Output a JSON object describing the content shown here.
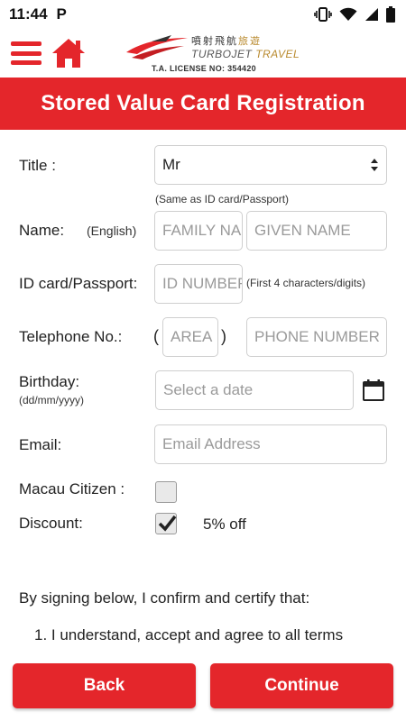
{
  "status_bar": {
    "time": "11:44",
    "app_badge": "P"
  },
  "header": {
    "logo": {
      "chinese_name": "噴射飛航",
      "chinese_suffix": "旅遊",
      "english_name": "TURBOJET",
      "english_suffix": "TRAVEL",
      "license": "T.A. LICENSE NO: 354420"
    },
    "icons": [
      "menu-icon",
      "home-icon"
    ]
  },
  "page_title": "Stored Value Card Registration",
  "form": {
    "title": {
      "label": "Title :",
      "value": "Mr",
      "note": "(Same as ID card/Passport)"
    },
    "name": {
      "label": "Name:",
      "sublabel": "(English)",
      "family_placeholder": "FAMILY NAME",
      "given_placeholder": "GIVEN NAME"
    },
    "id_card": {
      "label": "ID card/Passport:",
      "placeholder": "ID NUMBER",
      "note": "(First 4 characters/digits)"
    },
    "telephone": {
      "label": "Telephone No.:",
      "open_paren": "(",
      "close_paren": ")",
      "area_placeholder": "AREA",
      "phone_placeholder": "PHONE NUMBER"
    },
    "birthday": {
      "label": "Birthday:",
      "sublabel": "(dd/mm/yyyy)",
      "placeholder": "Select a date"
    },
    "email": {
      "label": "Email:",
      "placeholder": "Email Address"
    },
    "macau_citizen": {
      "label": "Macau Citizen :",
      "checked": false
    },
    "discount": {
      "label": "Discount:",
      "checked": true,
      "value": "5% off"
    }
  },
  "terms": {
    "intro": "By signing below, I confirm and certify that:",
    "item_1": "1. I understand, accept and agree to all terms"
  },
  "buttons": {
    "back": "Back",
    "continue": "Continue"
  },
  "colors": {
    "brand_red": "#e4262b",
    "logo_gold": "#b98a2e"
  }
}
